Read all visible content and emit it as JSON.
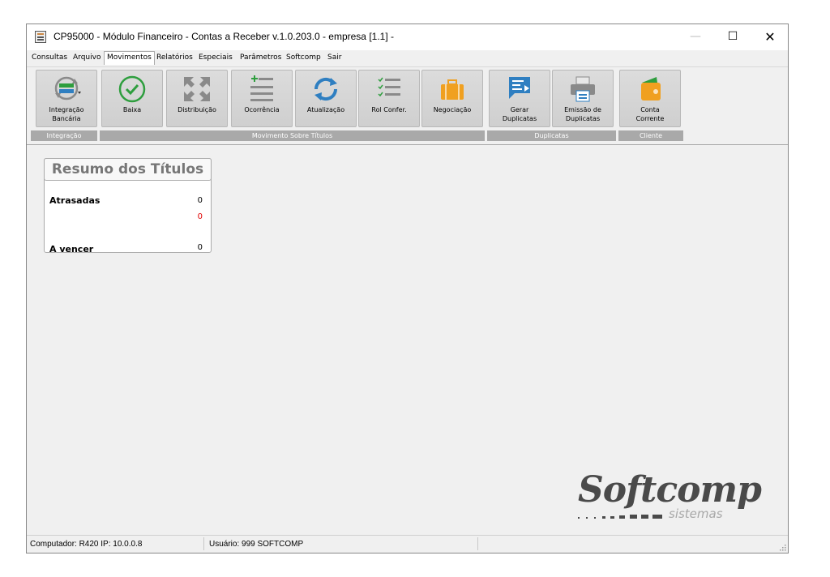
{
  "window": {
    "title": "CP95000 - Módulo Financeiro - Contas a Receber v.1.0.203.0 - empresa [1.1] -",
    "controls": {
      "minimize": "—",
      "maximize": "☐",
      "close": "✕"
    }
  },
  "menu": [
    {
      "label": "Consultas"
    },
    {
      "label": "Arquivo"
    },
    {
      "label": "Movimentos"
    },
    {
      "label": "Relatórios"
    },
    {
      "label": "Especiais"
    },
    {
      "label": "Parâmetros"
    },
    {
      "label": "Softcomp"
    },
    {
      "label": "Sair"
    }
  ],
  "ribbon": {
    "buttons": [
      {
        "label": "Integração\nBancária",
        "icon": "bank-sync-icon"
      },
      {
        "label": "Baixa",
        "icon": "check-circle-icon"
      },
      {
        "label": "Distribuição",
        "icon": "distribute-arrows-icon"
      },
      {
        "label": "Ocorrência",
        "icon": "add-list-icon"
      },
      {
        "label": "Atualização",
        "icon": "refresh-icon"
      },
      {
        "label": "Rol Confer.",
        "icon": "checklist-icon"
      },
      {
        "label": "Negociação",
        "icon": "briefcase-icon"
      },
      {
        "label": "Gerar\nDuplicatas",
        "icon": "generate-document-icon"
      },
      {
        "label": "Emissão de\nDuplicatas",
        "icon": "printer-icon"
      },
      {
        "label": "Conta\nCorrente",
        "icon": "wallet-icon"
      }
    ],
    "groups": [
      {
        "label": "Integração"
      },
      {
        "label": "Movimento Sobre Títulos"
      },
      {
        "label": "Duplicatas"
      },
      {
        "label": "Cliente"
      }
    ]
  },
  "summary": {
    "title": "Resumo dos Títulos",
    "overdue_label": "Atrasadas",
    "overdue_count": "0",
    "overdue_value": "0",
    "upcoming_label": "A vencer",
    "upcoming_count": "0"
  },
  "logo": {
    "main": "Softcomp",
    "sub": "sistemas"
  },
  "status": {
    "computer": "Computador: R420 IP: 10.0.0.8",
    "user": "Usuário: 999 SOFTCOMP"
  },
  "colors": {
    "ribbon_group": "#a9a9a9",
    "overdue_value": "#e00000",
    "icon_blue": "#2f7fc1",
    "icon_gray": "#8a8a8a",
    "icon_green": "#2e9e3e",
    "icon_orange": "#f0a020"
  }
}
